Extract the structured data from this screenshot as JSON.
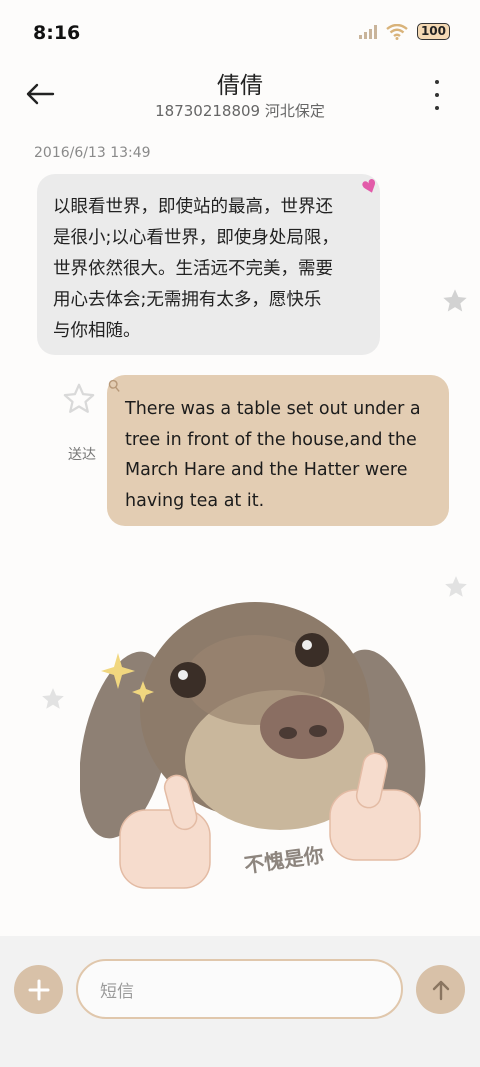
{
  "status_bar": {
    "time": "8:16",
    "battery": "100"
  },
  "header": {
    "contact_name": "倩倩",
    "contact_detail": "18730218809 河北保定"
  },
  "conversation": {
    "timestamp": "2016/6/13 13:49",
    "incoming_message": {
      "lines": [
        "以眼看世界，即使站的最高，世界还",
        "是很小;以心看世界，即使身处局限，",
        "世界依然很大。生活远不完美，需要",
        "用心去体会;无需拥有太多，愿快乐",
        "与你相随。"
      ]
    },
    "outgoing_message": {
      "lines": [
        "There was a table set out under a",
        "tree in front of the house,and the",
        "March Hare and the Hatter were",
        "having tea at it."
      ],
      "status": "送达"
    },
    "sticker": {
      "caption": "不愧是你"
    }
  },
  "composer": {
    "placeholder": "短信"
  },
  "colors": {
    "accent": "#d8c1a8",
    "outgoing_bubble": "#e3cdb3",
    "incoming_bubble": "#ebebeb"
  },
  "icons": [
    "back-arrow-icon",
    "more-vert-icon",
    "star-icon",
    "plus-icon",
    "send-arrow-icon",
    "signal-icon",
    "wifi-icon"
  ]
}
